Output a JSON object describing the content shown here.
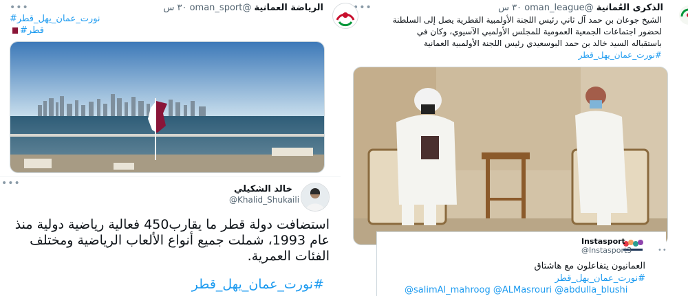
{
  "tweet_left": {
    "name": "الرياضة العمانية",
    "handle": "@oman_sport",
    "time": "٣٠ س",
    "hashtag1": "#نورت_عمان_يهل_قطر",
    "hashtag2": "#قطر",
    "flag": "qatar-flag"
  },
  "tweet_right": {
    "name": "الذكرى العُمانية",
    "handle": "@oman_league",
    "time": "٣٠ س",
    "line1": "الشيخ جوعان بن حمد آل ثاني رئيس اللجنة الأولمبية القطرية يصل إلى السلطنة",
    "line2": "لحضور اجتماعات الجمعية العمومية للمجلس الأولمبي الآسيوي، وكان في",
    "line3": "باستقباله السيد خالد بن حمد البوسعيدي رئيس اللجنة الأولمبية العمانية",
    "hashtag": "#نورت_عمان_يهل_قطر"
  },
  "tweet_khalid": {
    "name": "خالد الشكيلي",
    "handle": "@Khalid_Shukaili",
    "line1": "استضافت دولة قطر ما يقارب450 فعالية رياضية دولية منذ",
    "line2": "عام 1993، شملت جميع أنواع الألعاب الرياضية ومختلف",
    "line3": "الفئات العمرية.",
    "hashtag": "#نورت_عمان_يهل_قطر"
  },
  "tweet_insta": {
    "name": "Instasport",
    "handle": "@Instasport3",
    "text": "العمانيون يتفاعلون مع هاشتاق",
    "hashtag": "#نورت_عمان_يهل_قطر",
    "mentions": "@salimAl_mahroog @ALMasrouri @abdulla_blushi"
  },
  "colors": {
    "link": "#1d9bf0",
    "qatar_maroon": "#8a1538"
  }
}
